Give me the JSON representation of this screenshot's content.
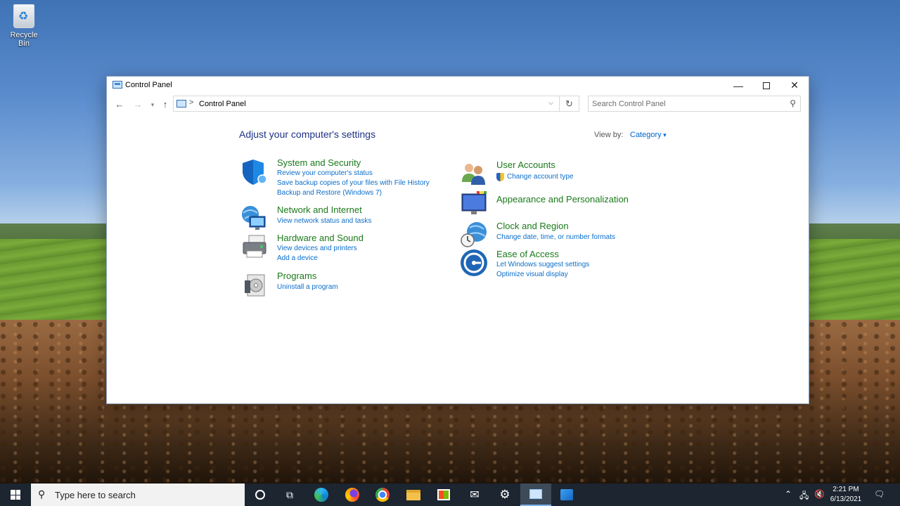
{
  "desktop": {
    "recycle_bin_label": "Recycle Bin"
  },
  "window": {
    "title": "Control Panel",
    "address": {
      "separator": ">",
      "path": "Control Panel"
    },
    "search": {
      "placeholder": "Search Control Panel"
    }
  },
  "main": {
    "heading": "Adjust your computer's settings",
    "view_by": {
      "label": "View by:",
      "value": "Category"
    }
  },
  "categories": {
    "system_security": {
      "title": "System and Security",
      "links": [
        "Review your computer's status",
        "Save backup copies of your files with File History",
        "Backup and Restore (Windows 7)"
      ]
    },
    "network_internet": {
      "title": "Network and Internet",
      "links": [
        "View network status and tasks"
      ]
    },
    "hardware_sound": {
      "title": "Hardware and Sound",
      "links": [
        "View devices and printers",
        "Add a device"
      ]
    },
    "programs": {
      "title": "Programs",
      "links": [
        "Uninstall a program"
      ]
    },
    "user_accounts": {
      "title": "User Accounts",
      "links": [
        "Change account type"
      ]
    },
    "appearance": {
      "title": "Appearance and Personalization",
      "links": []
    },
    "clock_region": {
      "title": "Clock and Region",
      "links": [
        "Change date, time, or number formats"
      ]
    },
    "ease_access": {
      "title": "Ease of Access",
      "links": [
        "Let Windows suggest settings",
        "Optimize visual display"
      ]
    }
  },
  "taskbar": {
    "search_text": "Type here to search",
    "apps": [
      "cortana-icon",
      "task-view-icon",
      "edge-icon",
      "firefox-icon",
      "chrome-icon",
      "file-explorer-icon",
      "store-icon",
      "mail-icon",
      "settings-icon",
      "control-panel-icon",
      "azure-data-studio-icon"
    ],
    "tray": [
      "chevron-up-icon",
      "network-icon",
      "volume-muted-icon"
    ],
    "time": "2:21 PM",
    "date": "6/13/2021"
  },
  "colors": {
    "category_title": "#1a7a1a",
    "link": "#0b6ec9",
    "heading": "#1e3287",
    "taskbar": "#1c2530"
  }
}
